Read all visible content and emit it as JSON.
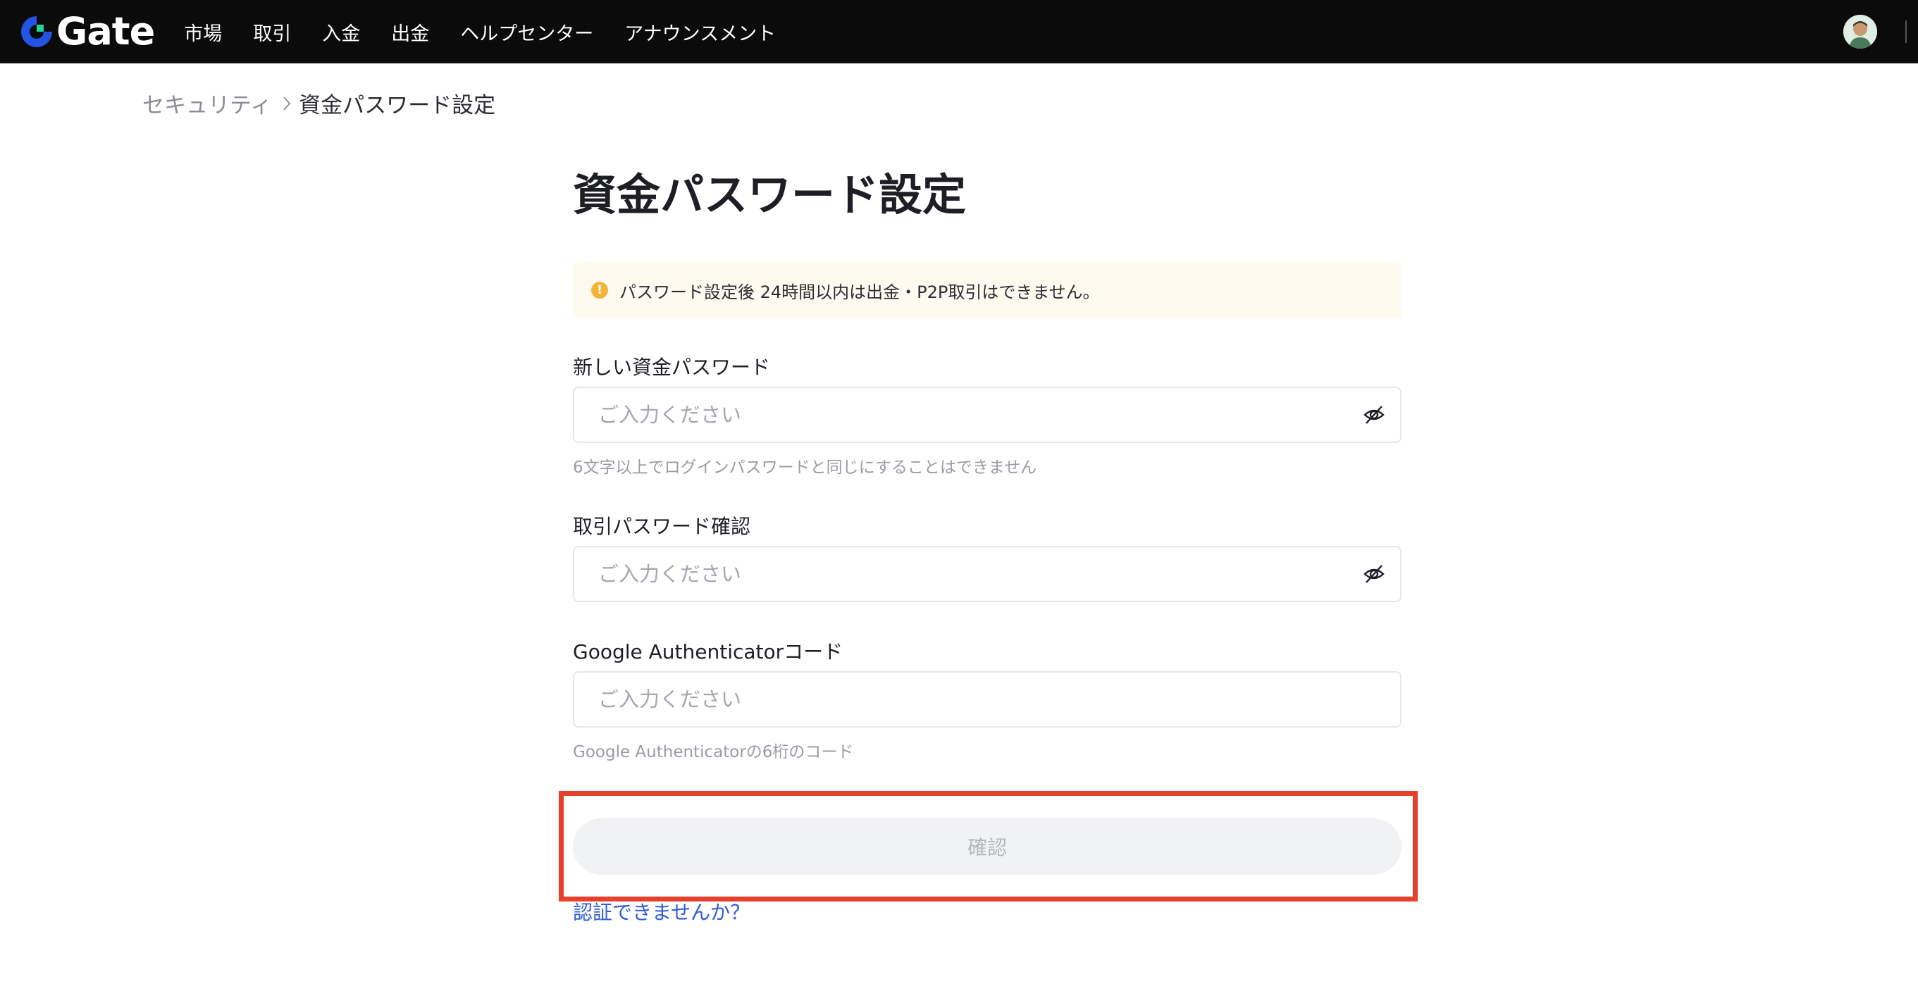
{
  "brand": {
    "name": "Gate",
    "accent": "#2354e6",
    "accent2": "#23d39a"
  },
  "nav": {
    "items": [
      "市場",
      "取引",
      "入金",
      "出金",
      "ヘルプセンター",
      "アナウンスメント"
    ]
  },
  "breadcrumb": {
    "parent": "セキュリティ",
    "current": "資金パスワード設定"
  },
  "page": {
    "title": "資金パスワード設定",
    "notice": "パスワード設定後 24時間以内は出金・P2P取引はできません。"
  },
  "form": {
    "new_password": {
      "label": "新しい資金パスワード",
      "placeholder": "ご入力ください",
      "hint": "6文字以上でログインパスワードと同じにすることはできません"
    },
    "confirm_password": {
      "label": "取引パスワード確認",
      "placeholder": "ご入力ください"
    },
    "google_auth": {
      "label": "Google Authenticatorコード",
      "placeholder": "ご入力ください",
      "hint": "Google Authenticatorの6桁のコード"
    },
    "confirm_button": "確認",
    "cant_verify_link": "認証できませんか？"
  },
  "colors": {
    "highlight_box": "#e5402b",
    "link": "#2f5bd9",
    "notice_bg": "#fffaf0",
    "notice_icon": "#f2b53a"
  }
}
